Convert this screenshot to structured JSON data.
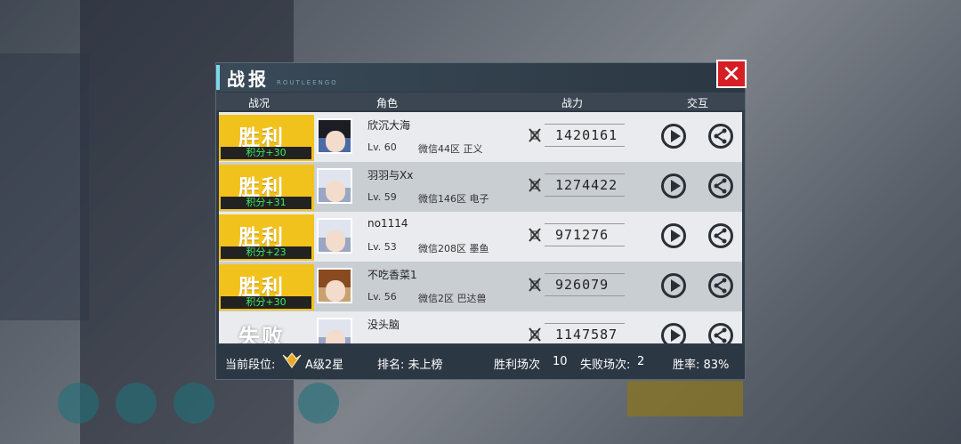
{
  "panel": {
    "title": "战报",
    "title_deco": "ROUTLEENGO"
  },
  "columns": {
    "status": "战况",
    "role": "角色",
    "power": "战力",
    "interact": "交互"
  },
  "rows": [
    {
      "result": "胜利",
      "points": "积分+30",
      "name": "欣沉大海",
      "level": "Lv. 60",
      "server": "微信44区 正义",
      "power": "1420161",
      "avatar": "dark-hair",
      "win": true
    },
    {
      "result": "胜利",
      "points": "积分+31",
      "name": "羽羽与Xx",
      "level": "Lv. 59",
      "server": "微信146区 电子",
      "power": "1274422",
      "avatar": "silver-hair",
      "win": true
    },
    {
      "result": "胜利",
      "points": "积分+23",
      "name": "no1114",
      "level": "Lv. 53",
      "server": "微信208区 墨鱼",
      "power": "971276",
      "avatar": "silver-hair",
      "win": true
    },
    {
      "result": "胜利",
      "points": "积分+30",
      "name": "不吃香菜1",
      "level": "Lv. 56",
      "server": "微信2区 巴达兽",
      "power": "926079",
      "avatar": "brown-hair",
      "win": true
    },
    {
      "result": "失败",
      "points": "",
      "name": "没头脑",
      "level": "",
      "server": "",
      "power": "1147587",
      "avatar": "silver-hair",
      "win": false
    }
  ],
  "footer": {
    "rank_label": "当前段位:",
    "rank_value": "A级2星",
    "ranking": "排名: 未上榜",
    "wins_label": "胜利场次",
    "wins_value": "10",
    "losses_label": "失败场次:",
    "losses_value": "2",
    "rate": "胜率: 83%"
  },
  "colors": {
    "win": "#f1c21b",
    "points_text": "#3ee86a",
    "close": "#d61e25",
    "title_accent": "#7fd8e6"
  },
  "icons": {
    "close": "close-icon",
    "play": "play-icon",
    "share": "share-icon",
    "power": "power-icon",
    "rank": "rank-badge-icon"
  }
}
